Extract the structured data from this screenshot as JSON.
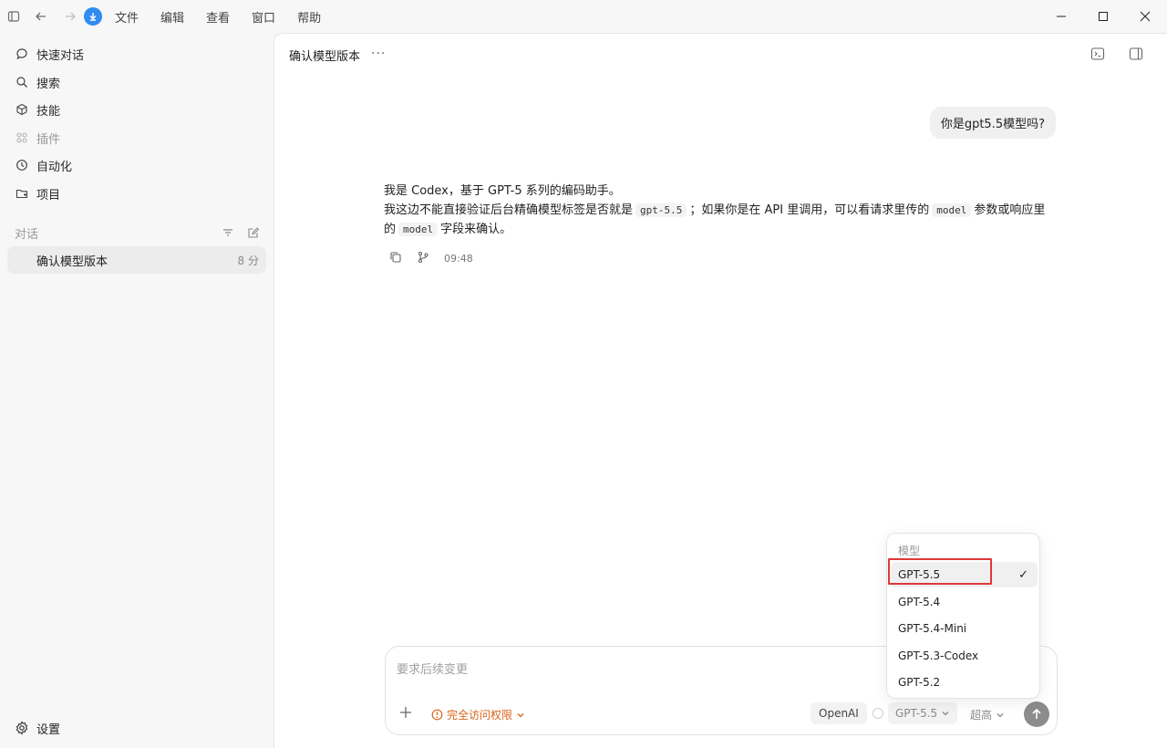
{
  "menu": [
    "文件",
    "编辑",
    "查看",
    "窗口",
    "帮助"
  ],
  "sidebar": {
    "items": [
      {
        "label": "快速对话",
        "icon": "chat-bubble-icon"
      },
      {
        "label": "搜索",
        "icon": "search-icon"
      },
      {
        "label": "技能",
        "icon": "cube-icon"
      },
      {
        "label": "插件",
        "icon": "grid-icon"
      },
      {
        "label": "自动化",
        "icon": "clock-icon"
      },
      {
        "label": "项目",
        "icon": "folder-icon"
      }
    ],
    "section_label": "对话",
    "conversation": {
      "title": "确认模型版本",
      "time": "8 分"
    },
    "settings_label": "设置"
  },
  "main": {
    "title": "确认模型版本",
    "more": "···",
    "user_message": "你是gpt5.5模型吗?",
    "assistant": {
      "line1": "我是 Codex，基于 GPT-5 系列的编码助手。",
      "line2_a": "我这边不能直接验证后台精确模型标签是否就是",
      "code1": "gpt-5.5",
      "line2_b": "；如果你是在 API 里调用，可以看请求里传的",
      "code2": "model",
      "line2_c": "参数或响应里",
      "line3_a": "的",
      "code3": "model",
      "line3_b": "字段来确认。",
      "timestamp": "09:48"
    }
  },
  "composer": {
    "placeholder": "要求后续变更",
    "access_label": "完全访问权限",
    "provider": "OpenAI",
    "model": "GPT-5.5",
    "effort": "超高"
  },
  "dropdown": {
    "label": "模型",
    "options": [
      "GPT-5.5",
      "GPT-5.4",
      "GPT-5.4-Mini",
      "GPT-5.3-Codex",
      "GPT-5.2"
    ],
    "selected": "GPT-5.5",
    "check": "✓"
  },
  "colors": {
    "accent_warning": "#d9631a",
    "highlight_box": "#e0373a",
    "download_badge": "#2f8cf0"
  }
}
